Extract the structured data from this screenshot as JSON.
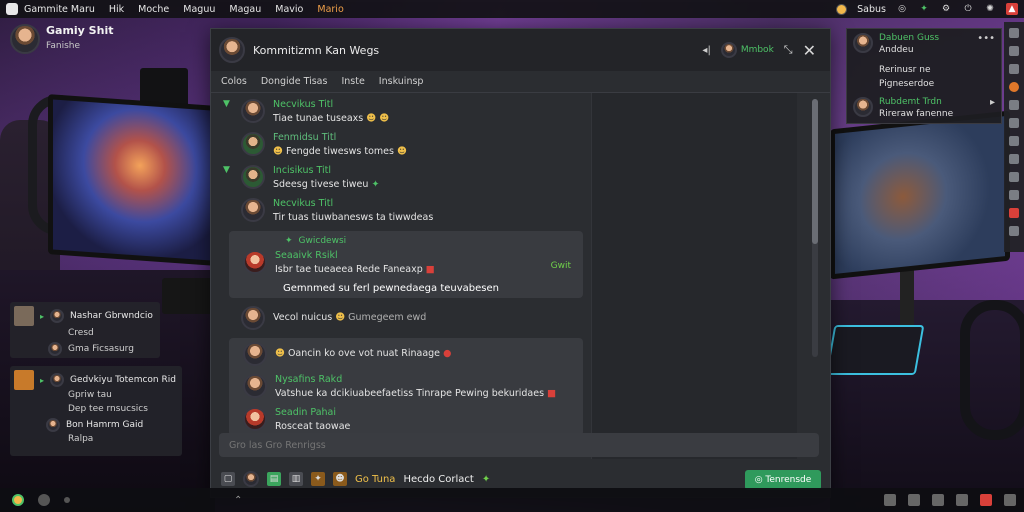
{
  "topbar": {
    "menu": [
      "Gammite Maru",
      "Hik",
      "Moche",
      "Maguu",
      "Magau",
      "Mavio",
      "Mario"
    ],
    "status_label": "Sabus"
  },
  "profile": {
    "name": "Gamiy Shit",
    "subtitle": "Fanishe"
  },
  "window": {
    "title": "Kommitizmn Kan Wegs",
    "online_label": "Mmbok",
    "subnav": [
      "Colos",
      "Dongide Tisas",
      "Inste",
      "Inskuinsp"
    ]
  },
  "messages": [
    {
      "name": "Necvikus Titl",
      "text": "Tiae tunae tuseaxs"
    },
    {
      "name": "Fenmidsu Titl",
      "text": "Fengde tiwesws tomes"
    },
    {
      "name": "Incisikus Titl",
      "text": "Sdeesg tivese tiweu"
    },
    {
      "name": "Necvikus Titl",
      "text": "Tir tuas tiuwbanesws ta tiwwdeas"
    }
  ],
  "bubble1": {
    "reaction": "Gwicdewsi",
    "name": "Seaaivk Rsikl",
    "text": "Isbr tae tueaeea Rede Faneaxp",
    "mention": "Gemnmed su ferl pewnedaega teuvabesen",
    "side_reaction": "Gwit"
  },
  "message_mid": {
    "text": "Vecol nuicus",
    "tail": "Gumegeem ewd"
  },
  "bubble2": {
    "msg_a": "Oancin ko ove vot nuat Rinaage",
    "name_b": "Nysafins Rakd",
    "msg_b": "Vatshue ka dcikiuabeefaetiss Tinrape Pewing bekuridaes",
    "name_c": "Seadin Pahai",
    "msg_c": "Rosceat taowae"
  },
  "input": {
    "placeholder": "Gro las Gro Renrigss"
  },
  "bottombar": {
    "label_a": "Go Tuna",
    "label_b": "Hecdo Corlact",
    "send_label": "Tenrensde"
  },
  "float_chat": {
    "card1": {
      "name": "Nashar Gbrwndcio",
      "sub1": "Cresd",
      "sub2": "Gma Ficsasurg"
    },
    "card2": {
      "name": "Gedvkiyu Totemcon Rid",
      "sub1": "Gpriw tau",
      "sub2": "Dep tee rnsucsics",
      "sub3": "Bon Hamrm Gaid",
      "sub4": "Ralpa"
    }
  },
  "right_panel": {
    "r1_name": "Dabuen Guss",
    "r1_text": "Anddeu",
    "r2_text": "Rerinusr ne",
    "r2_sub": "Pigneserdoe",
    "r3_name": "Rubdemt Trdn",
    "r3_text": "Rireraw fanenne"
  }
}
